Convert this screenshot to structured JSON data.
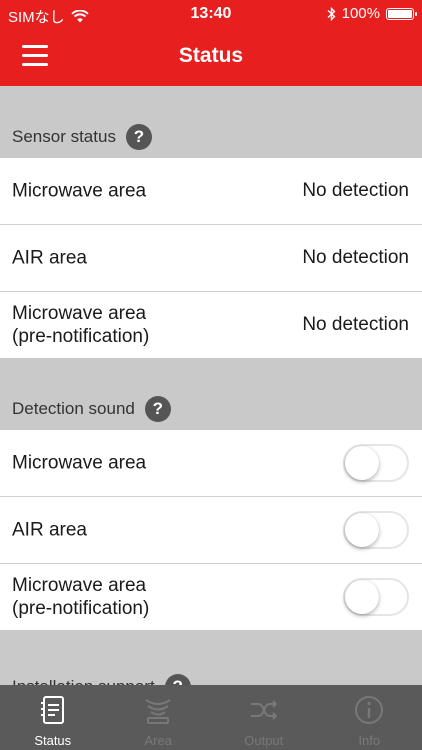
{
  "statusbar": {
    "carrier": "SIMなし",
    "time": "13:40",
    "battery": "100%",
    "battery_level": 1.0
  },
  "header": {
    "title": "Status"
  },
  "sections": {
    "sensor": {
      "title": "Sensor status",
      "help": "?",
      "rows": [
        {
          "label": "Microwave area",
          "value": "No detection"
        },
        {
          "label": "AIR area",
          "value": "No detection"
        },
        {
          "label_line1": "Microwave area",
          "label_line2": "(pre-notification)",
          "value": "No detection"
        }
      ]
    },
    "sound": {
      "title": "Detection sound",
      "help": "?",
      "rows": [
        {
          "label": "Microwave area",
          "on": false
        },
        {
          "label": "AIR area",
          "on": false
        },
        {
          "label_line1": "Microwave area",
          "label_line2": "(pre-notification)",
          "on": false
        }
      ]
    },
    "install": {
      "title": "Installation support",
      "help": "?"
    }
  },
  "tabs": [
    {
      "label": "Status",
      "icon": "document-icon",
      "active": true
    },
    {
      "label": "Area",
      "icon": "radar-icon",
      "active": false
    },
    {
      "label": "Output",
      "icon": "shuffle-icon",
      "active": false
    },
    {
      "label": "Info",
      "icon": "info-icon",
      "active": false
    }
  ],
  "colors": {
    "brand": "#e81f1f",
    "tabbar": "#5a5a5a",
    "background": "#c9c9c9"
  }
}
